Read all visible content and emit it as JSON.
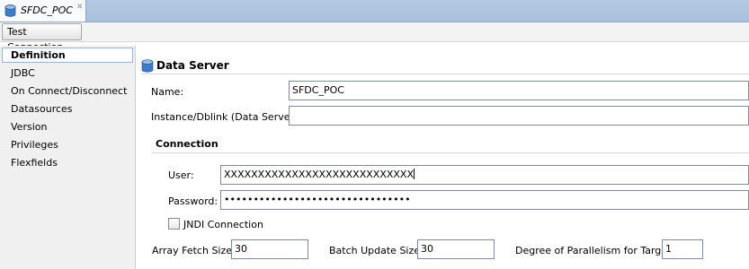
{
  "tab": {
    "title": "SFDC_POC",
    "close_glyph": "✕",
    "icon": "database-icon"
  },
  "toolbar": {
    "test_connection_label": "Test Connection"
  },
  "nav": {
    "items": [
      "Definition",
      "JDBC",
      "On Connect/Disconnect",
      "Datasources",
      "Version",
      "Privileges",
      "Flexfields"
    ],
    "selected": "Definition"
  },
  "data_server": {
    "title": "Data Server",
    "icon": "database-icon",
    "name_label": "Name:",
    "name_value": "SFDC_POC",
    "instance_label": "Instance/Dblink (Data Server):",
    "instance_value": ""
  },
  "connection": {
    "title": "Connection",
    "user_label": "User:",
    "user_value": "XXXXXXXXXXXXXXXXXXXXXXXXXXXX",
    "password_label": "Password:",
    "password_value": "••••••••••••••••••••••••••••••••",
    "jndi_label": "JNDI Connection",
    "jndi_checked": false
  },
  "fetch": {
    "array_fetch_label": "Array Fetch Size:",
    "array_fetch_value": "30",
    "batch_update_label": "Batch Update Size:",
    "batch_update_value": "30",
    "parallelism_label": "Degree of Parallelism for Target:",
    "parallelism_value": "1"
  },
  "colors": {
    "tab_strip": "#b4c9e2",
    "nav_bg": "#f0f0f0",
    "field_border": "#7f8b99"
  }
}
